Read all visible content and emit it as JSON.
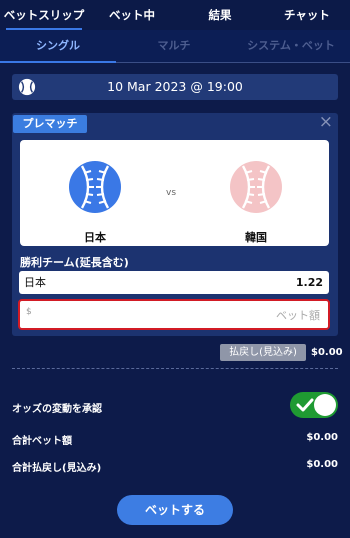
{
  "top_tabs": [
    "ベットスリップ",
    "ベット中",
    "結果",
    "チャット"
  ],
  "sub_tabs": [
    "シングル",
    "マルチ",
    "システム・ベット"
  ],
  "event": {
    "datetime": "10 Mar 2023 @ 19:00"
  },
  "card": {
    "badge": "プレマッチ",
    "close_symbol": "×",
    "vs": "vs",
    "home_team": "日本",
    "away_team": "韓国",
    "market": "勝利チーム(延長含む)",
    "selection": "日本",
    "odds": "1.22",
    "stake_currency": "$",
    "stake_placeholder": "ベット額"
  },
  "payout": {
    "label": "払戻し(見込み)",
    "value": "$0.00"
  },
  "accept_odds": {
    "label": "オッズの変動を承認",
    "enabled": true
  },
  "totals": {
    "stake_label": "合計ベット額",
    "stake_value": "$0.00",
    "payout_label": "合計払戻し(見込み)",
    "payout_value": "$0.00"
  },
  "bet_button": "ベットする",
  "colors": {
    "home_team": "#3a78e6",
    "away_team": "#f4c4c6",
    "accent": "#3d7de3",
    "toggle_on": "#1f9a32",
    "highlight": "#d21b25"
  },
  "icons": {
    "sport": "baseball-icon",
    "close": "close-icon",
    "toggle": "check-icon"
  }
}
